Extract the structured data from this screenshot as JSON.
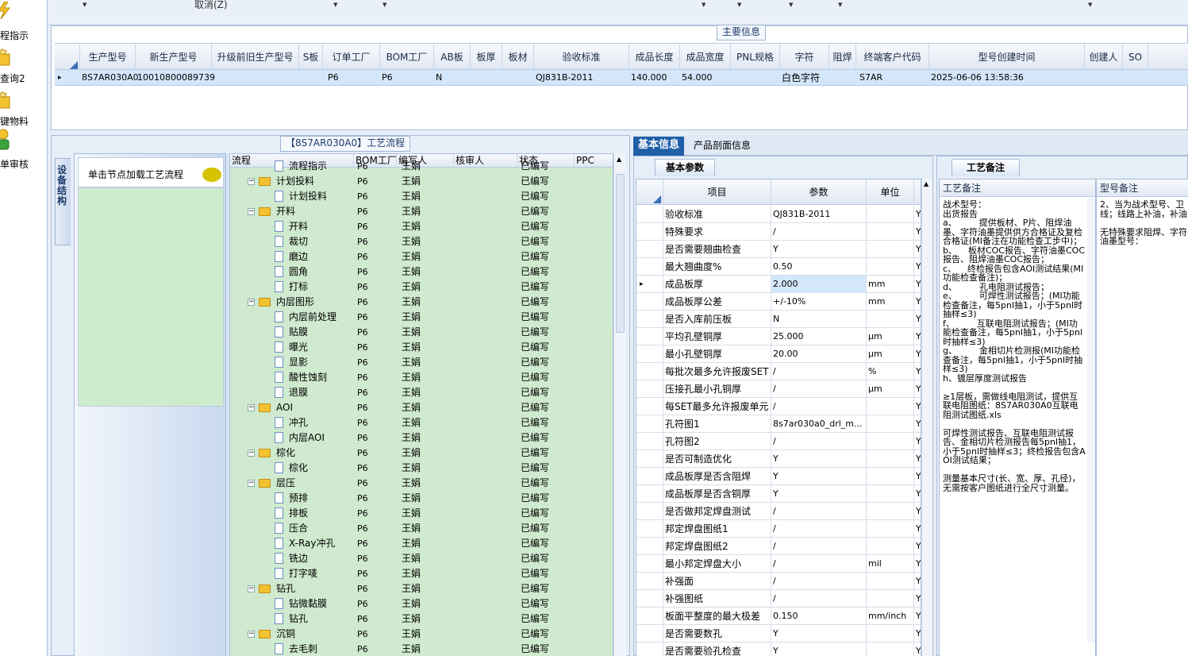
{
  "nav": {
    "items": [
      {
        "label": "程指示"
      },
      {
        "label": "查询2"
      },
      {
        "label": "键物料"
      },
      {
        "label": "单审核"
      }
    ]
  },
  "toolbar": {
    "cancel_label": "取消(Z)"
  },
  "main_info": {
    "title": "主要信息",
    "columns": [
      "生产型号",
      "新生产型号",
      "升级前旧生产型号",
      "S板",
      "订单工厂",
      "BOM工厂",
      "AB板",
      "板厚",
      "板材",
      "验收标准",
      "成品长度",
      "成品宽度",
      "PNL规格",
      "字符",
      "阻焊",
      "终端客户代码",
      "型号创建时间",
      "创建人",
      "SO"
    ],
    "row": [
      "8S7AR030A0",
      "10010800089739",
      "",
      "",
      "P6",
      "P6",
      "N",
      "",
      "",
      "QJ831B-2011",
      "140.000",
      "54.000",
      "",
      "白色字符",
      "",
      "S7AR",
      "2025-06-06 13:58:36",
      "",
      ""
    ]
  },
  "flow": {
    "title": "【8S7AR030A0】工艺流程",
    "vtab_label": "设备结构",
    "click_hint": "单击节点加载工艺流程",
    "columns": [
      "流程",
      "BOM工厂",
      "编写人",
      "核审人",
      "状态",
      "PPC"
    ],
    "rows": [
      {
        "name": "流程指示",
        "level": 2,
        "folder": false,
        "factory": "P6",
        "writer": "王娟",
        "status": "已编写"
      },
      {
        "name": "计划投料",
        "level": 1,
        "folder": true,
        "factory": "P6",
        "writer": "王娟",
        "status": "已编写"
      },
      {
        "name": "计划投料",
        "level": 2,
        "folder": false,
        "factory": "P6",
        "writer": "王娟",
        "status": "已编写"
      },
      {
        "name": "开料",
        "level": 1,
        "folder": true,
        "factory": "P6",
        "writer": "王娟",
        "status": "已编写"
      },
      {
        "name": "开料",
        "level": 2,
        "folder": false,
        "factory": "P6",
        "writer": "王娟",
        "status": "已编写"
      },
      {
        "name": "裁切",
        "level": 2,
        "folder": false,
        "factory": "P6",
        "writer": "王娟",
        "status": "已编写"
      },
      {
        "name": "磨边",
        "level": 2,
        "folder": false,
        "factory": "P6",
        "writer": "王娟",
        "status": "已编写"
      },
      {
        "name": "圆角",
        "level": 2,
        "folder": false,
        "factory": "P6",
        "writer": "王娟",
        "status": "已编写"
      },
      {
        "name": "打标",
        "level": 2,
        "folder": false,
        "factory": "P6",
        "writer": "王娟",
        "status": "已编写"
      },
      {
        "name": "内层图形",
        "level": 1,
        "folder": true,
        "factory": "P6",
        "writer": "王娟",
        "status": "已编写"
      },
      {
        "name": "内层前处理",
        "level": 2,
        "folder": false,
        "factory": "P6",
        "writer": "王娟",
        "status": "已编写"
      },
      {
        "name": "贴膜",
        "level": 2,
        "folder": false,
        "factory": "P6",
        "writer": "王娟",
        "status": "已编写"
      },
      {
        "name": "曝光",
        "level": 2,
        "folder": false,
        "factory": "P6",
        "writer": "王娟",
        "status": "已编写"
      },
      {
        "name": "显影",
        "level": 2,
        "folder": false,
        "factory": "P6",
        "writer": "王娟",
        "status": "已编写"
      },
      {
        "name": "酸性蚀刻",
        "level": 2,
        "folder": false,
        "factory": "P6",
        "writer": "王娟",
        "status": "已编写"
      },
      {
        "name": "退膜",
        "level": 2,
        "folder": false,
        "factory": "P6",
        "writer": "王娟",
        "status": "已编写"
      },
      {
        "name": "AOI",
        "level": 1,
        "folder": true,
        "factory": "P6",
        "writer": "王娟",
        "status": "已编写"
      },
      {
        "name": "冲孔",
        "level": 2,
        "folder": false,
        "factory": "P6",
        "writer": "王娟",
        "status": "已编写"
      },
      {
        "name": "内层AOI",
        "level": 2,
        "folder": false,
        "factory": "P6",
        "writer": "王娟",
        "status": "已编写"
      },
      {
        "name": "棕化",
        "level": 1,
        "folder": true,
        "factory": "P6",
        "writer": "王娟",
        "status": "已编写"
      },
      {
        "name": "棕化",
        "level": 2,
        "folder": false,
        "factory": "P6",
        "writer": "王娟",
        "status": "已编写"
      },
      {
        "name": "层压",
        "level": 1,
        "folder": true,
        "factory": "P6",
        "writer": "王娟",
        "status": "已编写"
      },
      {
        "name": "预排",
        "level": 2,
        "folder": false,
        "factory": "P6",
        "writer": "王娟",
        "status": "已编写"
      },
      {
        "name": "排板",
        "level": 2,
        "folder": false,
        "factory": "P6",
        "writer": "王娟",
        "status": "已编写"
      },
      {
        "name": "压合",
        "level": 2,
        "folder": false,
        "factory": "P6",
        "writer": "王娟",
        "status": "已编写"
      },
      {
        "name": "X-Ray冲孔",
        "level": 2,
        "folder": false,
        "factory": "P6",
        "writer": "王娟",
        "status": "已编写"
      },
      {
        "name": "铣边",
        "level": 2,
        "folder": false,
        "factory": "P6",
        "writer": "王娟",
        "status": "已编写"
      },
      {
        "name": "打字唛",
        "level": 2,
        "folder": false,
        "factory": "P6",
        "writer": "王娟",
        "status": "已编写"
      },
      {
        "name": "钻孔",
        "level": 1,
        "folder": true,
        "factory": "P6",
        "writer": "王娟",
        "status": "已编写"
      },
      {
        "name": "钻微黏膜",
        "level": 2,
        "folder": false,
        "factory": "P6",
        "writer": "王娟",
        "status": "已编写"
      },
      {
        "name": "钻孔",
        "level": 2,
        "folder": false,
        "factory": "P6",
        "writer": "王娟",
        "status": "已编写"
      },
      {
        "name": "沉铜",
        "level": 1,
        "folder": true,
        "factory": "P6",
        "writer": "王娟",
        "status": "已编写"
      },
      {
        "name": "去毛刺",
        "level": 2,
        "folder": false,
        "factory": "P6",
        "writer": "王娟",
        "status": "已编写"
      }
    ]
  },
  "right_tabs": {
    "basic": "基本信息",
    "profile": "产品剖面信息"
  },
  "params": {
    "tab_label": "基本参数",
    "columns": [
      "项目",
      "参数",
      "单位"
    ],
    "rows": [
      {
        "item": "验收标准",
        "value": "QJ831B-2011",
        "unit": "",
        "flag": "Y"
      },
      {
        "item": "特殊要求",
        "value": "/",
        "unit": "",
        "flag": "Y"
      },
      {
        "item": "是否需要翘曲检查",
        "value": "Y",
        "unit": "",
        "flag": "Y"
      },
      {
        "item": "最大翘曲度%",
        "value": "0.50",
        "unit": "",
        "flag": "Y"
      },
      {
        "item": "成品板厚",
        "value": "2.000",
        "unit": "mm",
        "flag": "Y"
      },
      {
        "item": "成品板厚公差",
        "value": "+/-10%",
        "unit": "mm",
        "flag": "Y"
      },
      {
        "item": "是否入库前压板",
        "value": "N",
        "unit": "",
        "flag": "Y"
      },
      {
        "item": "平均孔壁铜厚",
        "value": "25.000",
        "unit": "μm",
        "flag": "Y"
      },
      {
        "item": "最小孔壁铜厚",
        "value": "20.00",
        "unit": "μm",
        "flag": "Y"
      },
      {
        "item": "每批次最多允许报废SET",
        "value": "/",
        "unit": "%",
        "flag": "Y"
      },
      {
        "item": "压接孔最小孔铜厚",
        "value": "/",
        "unit": "μm",
        "flag": "Y"
      },
      {
        "item": "每SET最多允许报废单元",
        "value": "/",
        "unit": "",
        "flag": "Y"
      },
      {
        "item": "孔符图1",
        "value": "8s7ar030a0_drl_m...",
        "unit": "",
        "flag": "Y"
      },
      {
        "item": "孔符图2",
        "value": "/",
        "unit": "",
        "flag": "Y"
      },
      {
        "item": "是否可制造优化",
        "value": "Y",
        "unit": "",
        "flag": "Y"
      },
      {
        "item": "成品板厚是否含阻焊",
        "value": "Y",
        "unit": "",
        "flag": "Y"
      },
      {
        "item": "成品板厚是否含铜厚",
        "value": "Y",
        "unit": "",
        "flag": "Y"
      },
      {
        "item": "是否做邦定焊盘测试",
        "value": "/",
        "unit": "",
        "flag": "Y"
      },
      {
        "item": "邦定焊盘图纸1",
        "value": "/",
        "unit": "",
        "flag": "Y"
      },
      {
        "item": "邦定焊盘图纸2",
        "value": "/",
        "unit": "",
        "flag": "Y"
      },
      {
        "item": "最小邦定焊盘大小",
        "value": "/",
        "unit": "mil",
        "flag": "Y"
      },
      {
        "item": "补强面",
        "value": "/",
        "unit": "",
        "flag": "Y"
      },
      {
        "item": "补强图纸",
        "value": "/",
        "unit": "",
        "flag": "Y"
      },
      {
        "item": "板面平整度的最大极差",
        "value": "0.150",
        "unit": "mm/inch",
        "flag": "Y"
      },
      {
        "item": "是否需要数孔",
        "value": "Y",
        "unit": "",
        "flag": "Y"
      },
      {
        "item": "是否需要验孔检查",
        "value": "Y",
        "unit": "",
        "flag": "Y"
      }
    ]
  },
  "notes": {
    "tab_label": "工艺备注",
    "process_header": "工艺备注",
    "model_header": "型号备注",
    "process_text": "战术型号：\n出货报告\na、        提供板材、P片、阻焊油墨、字符油墨提供供方合格证及复检合格证(MI备注在功能检查工步中)；\nb、    板材COC报告、字符油墨COC报告、阻焊油墨COC报告；\nc、    终检报告包含AOI测试结果(MI功能检查备注)；\nd、        孔电阻测试报告；\ne、        可焊性测试报告；(MI功能检查备注，每5pnl抽1，小于5pnl时抽样≤3)\nf、        互联电阻测试报告；(MI功能检查备注，每5pnl抽1，小于5pnl时抽样≤3)\ng、        金相切片检测报(MI功能检查备注，每5pnl抽1，小于5pnl时抽样≤3)\nh、镀层厚度测试报告\n\n≥1层板，需做线电阻测试，提供互联电阻图纸：8S7AR030A0互联电阻测试图纸.xls\n\n可焊性测试报告、互联电阻测试报告、金相切片检测报告每5pnl抽1，小于5pnl时抽样≤3；终检报告包含AOI测试结果；\n\n测量基本尺寸(长、宽、厚、孔径)，无需按客户图纸进行全尺寸测量。",
    "model_text": "2、当为战术型号、卫线；线路上补油，补油\n\n无特殊要求阻焊、字符油墨型号："
  },
  "colors": {
    "accent": "#1f5fa8",
    "grid_green": "#cfeacf",
    "selected_row": "#d4e6fa"
  }
}
